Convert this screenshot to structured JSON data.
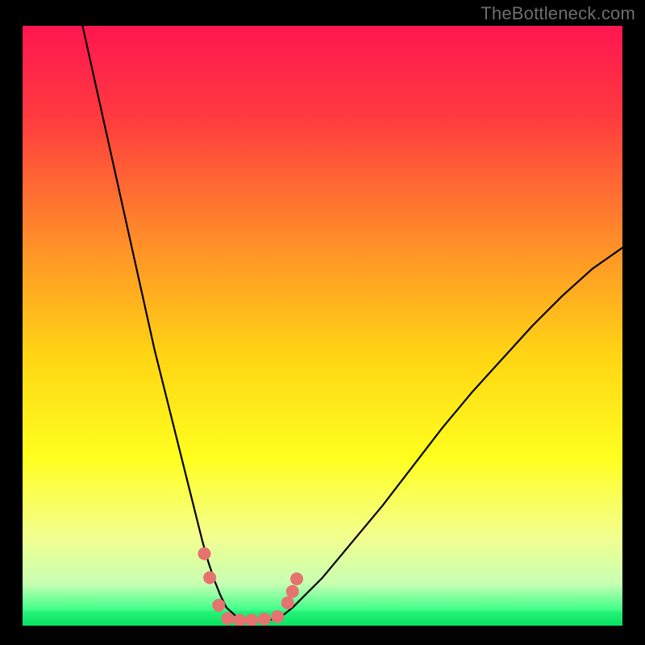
{
  "watermark": "TheBottleneck.com",
  "chart_data": {
    "type": "line",
    "title": "",
    "xlabel": "",
    "ylabel": "",
    "xlim": [
      0,
      100
    ],
    "ylim": [
      0,
      100
    ],
    "grid": false,
    "legend": "none",
    "series": [
      {
        "name": "curve",
        "x": [
          10,
          12,
          14,
          16,
          18,
          20,
          22,
          24,
          26,
          28,
          30,
          31,
          32,
          33,
          34,
          36,
          38,
          40,
          42.5,
          45,
          50,
          55,
          60,
          65,
          70,
          75,
          80,
          85,
          90,
          95,
          100
        ],
        "y": [
          100,
          91,
          82,
          73,
          64,
          55,
          46,
          38,
          30,
          22,
          14,
          10.5,
          7.5,
          5,
          3,
          1.2,
          1,
          1,
          1,
          3,
          8,
          14,
          20,
          26.5,
          33,
          39,
          44.5,
          50,
          55,
          59.5,
          63
        ]
      }
    ],
    "green_band": {
      "y_start": 0,
      "y_end": 2.5
    },
    "markers": {
      "name": "highlighted-points",
      "color": "#e5736f",
      "points": [
        {
          "x": 30.3,
          "y": 12
        },
        {
          "x": 31.2,
          "y": 8
        },
        {
          "x": 32.7,
          "y": 3.4
        },
        {
          "x": 34.2,
          "y": 1.2
        },
        {
          "x": 36.2,
          "y": 0.9
        },
        {
          "x": 38.2,
          "y": 0.9
        },
        {
          "x": 40.3,
          "y": 1.1
        },
        {
          "x": 42.5,
          "y": 1.5
        },
        {
          "x": 44.2,
          "y": 3.8
        },
        {
          "x": 45.0,
          "y": 5.7
        },
        {
          "x": 45.7,
          "y": 7.8
        }
      ]
    },
    "gradient_stops": [
      {
        "offset": 0.0,
        "color": "#ff1650"
      },
      {
        "offset": 0.15,
        "color": "#ff3a3f"
      },
      {
        "offset": 0.35,
        "color": "#ff8a2a"
      },
      {
        "offset": 0.55,
        "color": "#ffd514"
      },
      {
        "offset": 0.72,
        "color": "#ffff1f"
      },
      {
        "offset": 0.85,
        "color": "#f3ff8e"
      },
      {
        "offset": 0.93,
        "color": "#c8ffb3"
      },
      {
        "offset": 0.975,
        "color": "#3bff88"
      },
      {
        "offset": 1.0,
        "color": "#05e56a"
      }
    ]
  }
}
